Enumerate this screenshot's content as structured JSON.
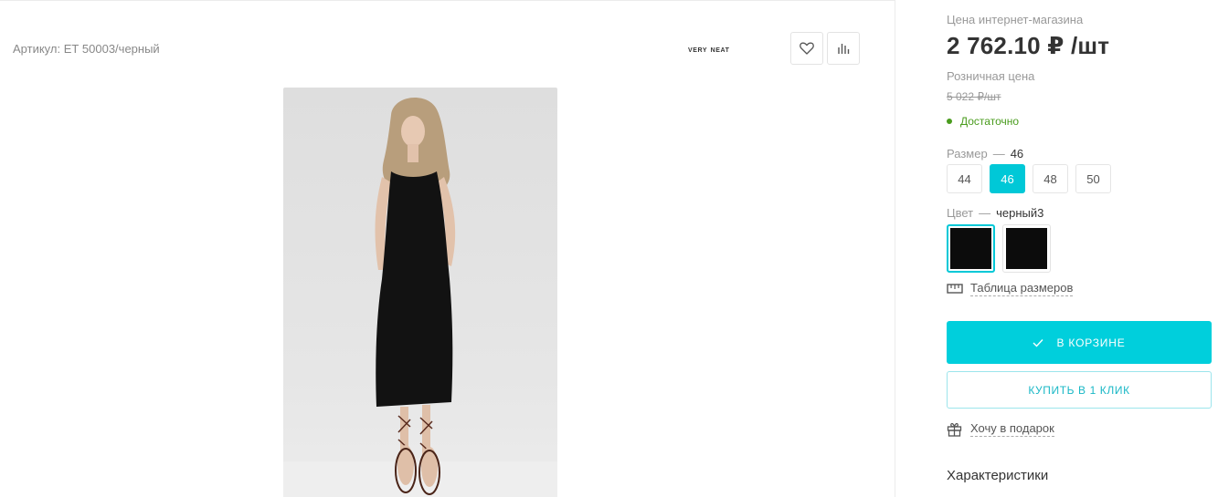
{
  "product": {
    "article": "Артикул: ЕТ 50003/черный",
    "brand": "very neat"
  },
  "pricing": {
    "online_label": "Цена интернет-магазина",
    "online_price": "2 762.10 ₽ /шт",
    "retail_label": "Розничная цена",
    "retail_price": "5 022 ₽/шт"
  },
  "stock": {
    "text": "Достаточно",
    "color": "#4a9c1e"
  },
  "size": {
    "label": "Размер",
    "separator": "—",
    "selected": "46",
    "options": [
      "44",
      "46",
      "48",
      "50"
    ]
  },
  "color": {
    "label": "Цвет",
    "separator": "—",
    "selected": "черный3",
    "swatches": [
      "#0c0c0c",
      "#0c0c0c"
    ]
  },
  "links": {
    "size_table": "Таблица размеров",
    "gift": "Хочу в подарок",
    "specs": "Характеристики"
  },
  "buttons": {
    "cart": "В КОРЗИНЕ",
    "one_click": "КУПИТЬ В 1 КЛИК"
  },
  "icons": {
    "favorite": "heart-icon",
    "compare": "bar-chart-icon",
    "cart_check": "check-icon",
    "ruler": "ruler-icon",
    "gift": "gift-icon"
  },
  "theme": {
    "accent": "#00cfdc"
  }
}
